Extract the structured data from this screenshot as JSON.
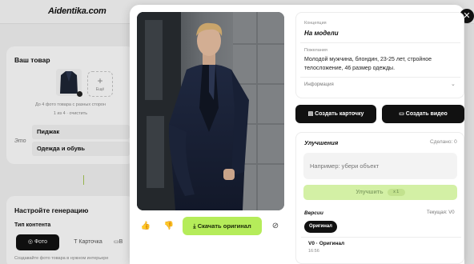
{
  "background": {
    "logo": "Aidentika.com",
    "product_title": "Ваш товар",
    "add_more_label": "Ещё",
    "photo_hint": "До 4 фото товара с разных сторон",
    "photo_count": "1 из 4 · очистить",
    "eto_label": "Это",
    "item_name": "Пиджак",
    "item_category": "Одежда и обувь",
    "gen_title": "Настройте генерацию",
    "content_type_label": "Тип контента",
    "tab_photo": "Фото",
    "tab_card": "Карточка",
    "tab_video_partial": "В",
    "footer_hint": "Создавайте фото товара в нужном интерьере"
  },
  "modal": {
    "close_glyph": "✕",
    "like_glyph": "👍",
    "dislike_glyph": "👎",
    "hide_glyph": "⊘",
    "download_label": "Скачать оригинал",
    "concept": {
      "label": "Концепция",
      "value": "На модели"
    },
    "prompt": {
      "label": "Пожелания",
      "text": "Молодой мужчина, блондин, 23-25 лет, стройное телосложение, 46 размер одежды."
    },
    "info_label": "Информация",
    "create_card_label": "Создать карточку",
    "create_video_label": "Создать видео",
    "improvements": {
      "title": "Улучшения",
      "count": "Сделано: 0",
      "placeholder": "Например: убери объект",
      "button_label": "Улучшить",
      "cost_badge": "x 1"
    },
    "versions": {
      "title": "Версии",
      "current": "Текущая: V0",
      "pill_label": "Оригинал",
      "entry_name": "V0 · Оригинал",
      "entry_time": "16:56"
    }
  },
  "colors": {
    "accent_green": "#b5ec5a",
    "dark_button": "#111111",
    "improve_disabled": "#d3f0a5"
  }
}
